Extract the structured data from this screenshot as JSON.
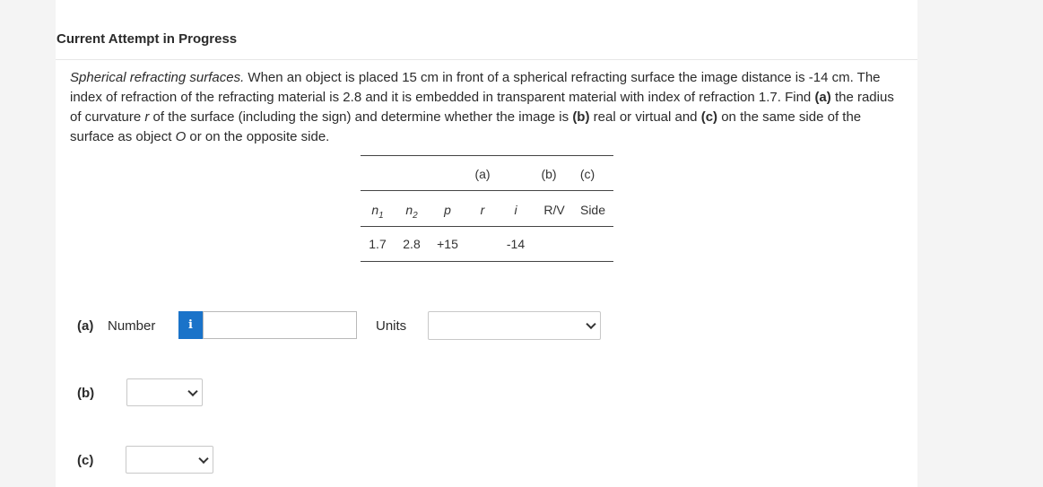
{
  "header": {
    "title": "Current Attempt in Progress"
  },
  "problem": {
    "title": "Spherical refracting surfaces.",
    "s1": " When an object is placed 15 cm in front of a spherical refracting surface the image distance is -14 cm. The index of refraction of the refracting material is 2.8 and it is embedded in transparent material with index of refraction 1.7. Find ",
    "a": "(a)",
    "s2": " the radius of curvature ",
    "r": "r",
    "s3": " of the surface (including the sign) and determine whether the image is ",
    "b": "(b)",
    "s4": " real or virtual and ",
    "c": "(c)",
    "s5": " on the same side of the surface as object ",
    "o": "O",
    "s6": " or on the opposite side."
  },
  "table": {
    "group_a": "(a)",
    "group_b": "(b)",
    "group_c": "(c)",
    "n": "n",
    "sub1": "1",
    "sub2": "2",
    "p": "p",
    "r": "r",
    "i": "i",
    "rv": "R/V",
    "side": "Side",
    "row": {
      "n1": "1.7",
      "n2": "2.8",
      "p": "+15",
      "r": "",
      "i": "-14",
      "rv": "",
      "side": ""
    }
  },
  "answers": {
    "a_label": "(a)",
    "number_label": "Number",
    "info_icon": "i",
    "number_value": "",
    "units_label": "Units",
    "units_value": "",
    "b_label": "(b)",
    "b_value": "",
    "c_label": "(c)",
    "c_value": ""
  },
  "colors": {
    "info_button": "#1a73c9"
  }
}
